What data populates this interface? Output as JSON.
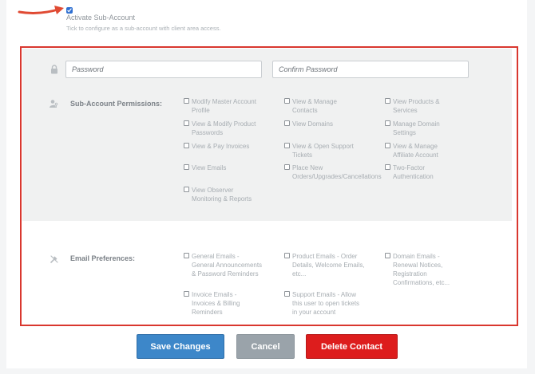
{
  "activate": {
    "label": "Activate Sub-Account",
    "help": "Tick to configure as a sub-account with client area access.",
    "checked": true
  },
  "password": {
    "placeholder": "Password",
    "confirm_placeholder": "Confirm Password"
  },
  "permissions": {
    "label": "Sub-Account Permissions:",
    "options": [
      "Modify Master Account\nProfile",
      "View & Modify Product\nPasswords",
      "View & Pay Invoices",
      "View Emails",
      "View Observer\nMonitoring & Reports",
      "View & Manage\nContacts",
      "View Domains",
      "View & Open Support\nTickets",
      "Place New\nOrders/Upgrades/Cancellations",
      "View Products &\nServices",
      "Manage Domain\nSettings",
      "View & Manage\nAffiliate Account",
      "Two-Factor\nAuthentication"
    ]
  },
  "email_prefs": {
    "label": "Email Preferences:",
    "options": [
      "General Emails -\nGeneral Announcements\n& Password Reminders",
      "Invoice Emails -\nInvoices & Billing\nReminders",
      "Product Emails - Order\nDetails, Welcome Emails,\netc...",
      "Support Emails - Allow\nthis user to open tickets\nin your account",
      "Domain Emails -\nRenewal Notices,\nRegistration\nConfirmations, etc..."
    ]
  },
  "buttons": {
    "save": "Save Changes",
    "cancel": "Cancel",
    "delete": "Delete Contact"
  },
  "icons": {
    "lock": "lock-icon",
    "permissions": "user-key-icon",
    "email": "tools-icon",
    "arrow": "red-arrow-icon"
  },
  "colors": {
    "highlight": "#d9372f",
    "primary": "#3d87c9",
    "danger": "#dd1d1d",
    "muted": "#9aa3aa"
  }
}
